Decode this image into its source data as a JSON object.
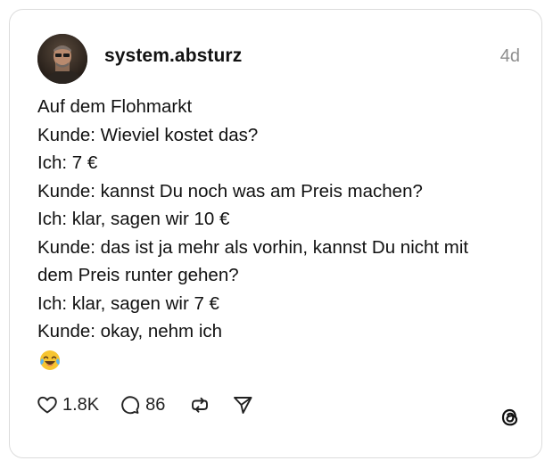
{
  "post": {
    "username": "system.absturz",
    "time": "4d",
    "lines": [
      "Auf dem Flohmarkt",
      "Kunde: Wieviel kostet das?",
      "Ich: 7 €",
      "Kunde: kannst Du noch was am Preis machen?",
      "Ich: klar, sagen wir 10 €",
      "Kunde: das ist ja mehr als vorhin, kannst Du nicht mit",
      "dem Preis runter gehen?",
      "Ich: klar, sagen wir 7 €",
      "Kunde: okay, nehm ich"
    ],
    "emoji": "face-with-tears-of-joy"
  },
  "actions": {
    "like_count": "1.8K",
    "reply_count": "86",
    "repost_icon": "repost-icon",
    "share_icon": "send-icon"
  },
  "brand": {
    "logo_icon": "threads-logo-icon"
  },
  "colors": {
    "text": "#111111",
    "muted": "#8e8e8e",
    "border": "#dcdcdc",
    "emoji_face": "#f7c531"
  }
}
